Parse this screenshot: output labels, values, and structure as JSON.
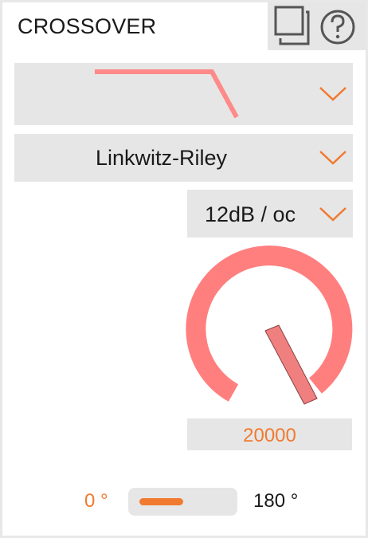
{
  "header": {
    "title": "CROSSOVER"
  },
  "top_buttons": {
    "copy_icon": "copy-icon",
    "help_icon": "help-icon"
  },
  "filter_shape": {
    "icon": "low-pass-curve-icon"
  },
  "filter_type": {
    "selected": "Linkwitz-Riley"
  },
  "slope": {
    "selected": "12dB / oc"
  },
  "frequency": {
    "value": "20000"
  },
  "phase": {
    "left_label": "0 °",
    "right_label": "180 °",
    "state": "0"
  },
  "colors": {
    "accent": "#f07a30",
    "knob": "#ff7f7f",
    "control_bg": "#e6e6e6"
  }
}
